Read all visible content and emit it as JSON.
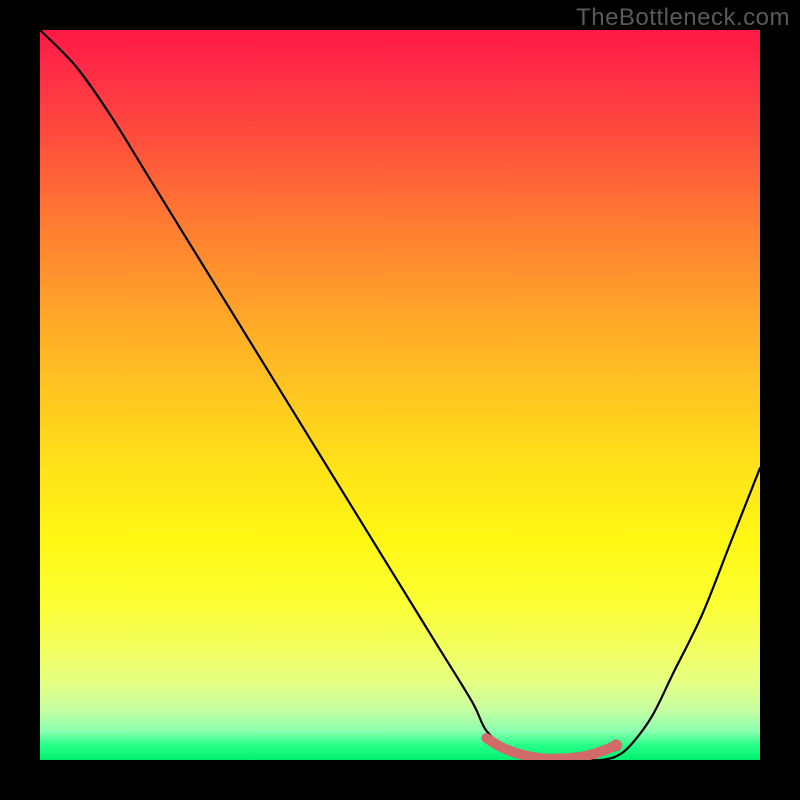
{
  "watermark": "TheBottleneck.com",
  "chart_data": {
    "type": "line",
    "title": "",
    "xlabel": "",
    "ylabel": "",
    "xlim": [
      0,
      100
    ],
    "ylim": [
      0,
      100
    ],
    "gradient": {
      "top_color": "#ff1846",
      "bottom_color": "#00f070",
      "description": "red-to-yellow-to-green vertical gradient"
    },
    "series": [
      {
        "name": "bottleneck-curve",
        "color": "#000000",
        "x": [
          0,
          5,
          10,
          15,
          20,
          25,
          30,
          35,
          40,
          45,
          50,
          55,
          60,
          62,
          65,
          68,
          70,
          72,
          74,
          76,
          78,
          80,
          82,
          85,
          88,
          92,
          96,
          100
        ],
        "y": [
          100,
          95,
          88,
          80,
          72,
          64,
          56,
          48,
          40,
          32,
          24,
          16,
          8,
          4,
          1.5,
          0.5,
          0,
          0,
          0,
          0,
          0,
          0.5,
          2,
          6,
          12,
          20,
          30,
          40
        ]
      },
      {
        "name": "optimal-range-marker",
        "color": "#d26a6a",
        "x": [
          62,
          64,
          66,
          68,
          70,
          72,
          74,
          76,
          78,
          80
        ],
        "y": [
          3,
          1.8,
          1,
          0.5,
          0.2,
          0.2,
          0.3,
          0.6,
          1.2,
          2
        ]
      }
    ]
  }
}
